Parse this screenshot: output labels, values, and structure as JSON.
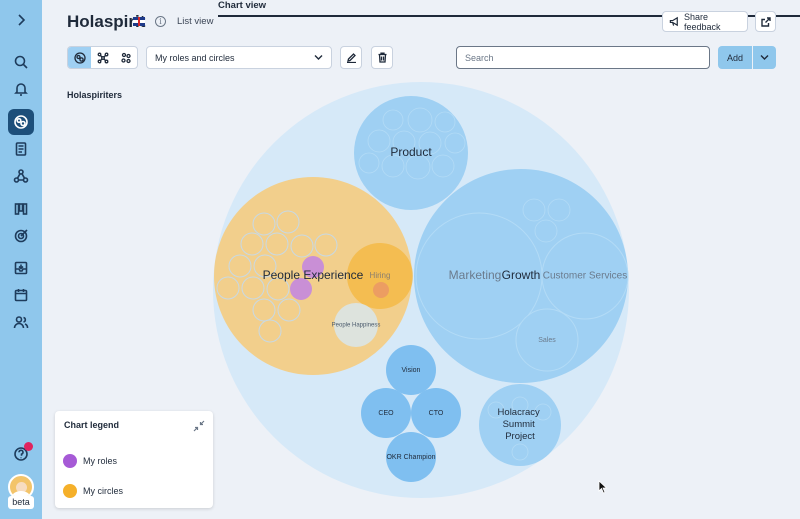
{
  "header": {
    "brand": "Holaspirit",
    "info_glyph": "i",
    "tabs": [
      {
        "label": "List view",
        "active": false
      },
      {
        "label": "Chart view",
        "active": true
      }
    ],
    "share_feedback": "Share feedback",
    "open_external_icon": "external-link-icon"
  },
  "toolbar": {
    "dropdown_value": "My roles and circles",
    "search_placeholder": "Search",
    "add_label": "Add"
  },
  "sidebar": {
    "items": [
      "expand-icon",
      "search-icon",
      "bell-icon",
      "chart-icon",
      "document-icon",
      "network-icon",
      "board-icon",
      "target-icon",
      "inbox-icon",
      "calendar-icon",
      "people-icon"
    ],
    "help_glyph": "?",
    "beta_label": "beta"
  },
  "organization": "Holaspiriters",
  "circles": {
    "product": "Product",
    "people_experience": "People Experience",
    "hiring": "Hiring",
    "people_happiness": "People Happiness",
    "growth": "Growth",
    "marketing": "Marketing",
    "customer_services": "Customer Services",
    "sales": "Sales",
    "vision": "Vision",
    "ceo": "CEO",
    "cto": "CTO",
    "okr_champion": "OKR Champion",
    "holacracy_summit": "Holacracy Summit Project"
  },
  "legend": {
    "title": "Chart legend",
    "items": [
      {
        "label": "My roles",
        "color": "#a65ad6"
      },
      {
        "label": "My circles",
        "color": "#f5b02a"
      }
    ]
  },
  "colors": {
    "circle_fill": "#9fd0f3",
    "outer_fill": "#d6e9f8",
    "people_fill": "#f2cf8c",
    "role_fill": "#c98fd6"
  }
}
